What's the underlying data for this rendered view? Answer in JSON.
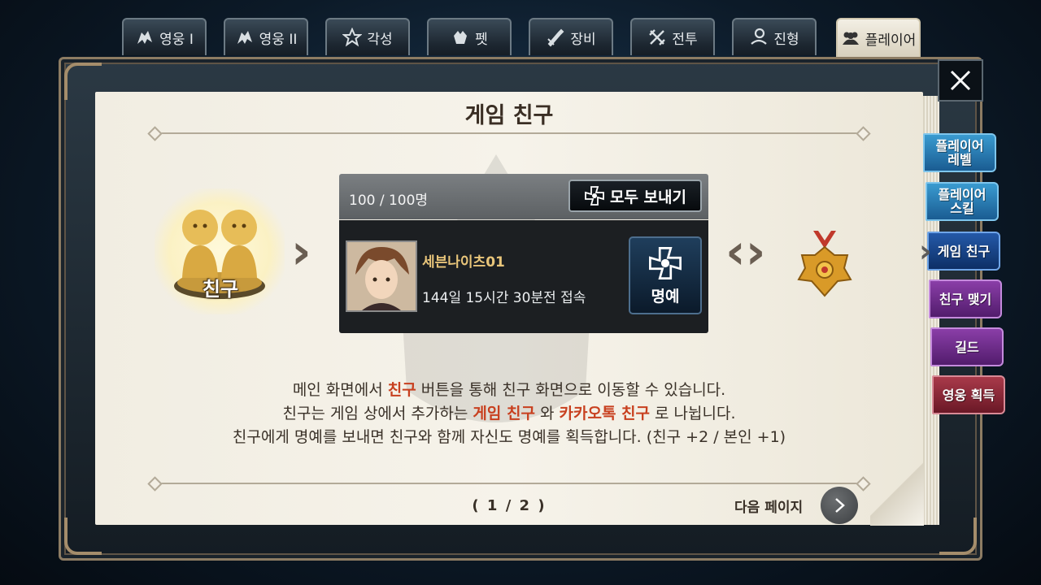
{
  "tabs": [
    {
      "label": "영웅 I",
      "icon": "hero-icon"
    },
    {
      "label": "영웅 II",
      "icon": "hero-icon"
    },
    {
      "label": "각성",
      "icon": "awakening-icon"
    },
    {
      "label": "펫",
      "icon": "pet-icon"
    },
    {
      "label": "장비",
      "icon": "equipment-icon"
    },
    {
      "label": "전투",
      "icon": "crossed-swords-icon"
    },
    {
      "label": "진형",
      "icon": "formation-icon"
    },
    {
      "label": "플레이어",
      "icon": "players-icon",
      "active": true
    }
  ],
  "page": {
    "title": "게임 친구",
    "badge_label": "친구",
    "pager": "( 1 / 2 )",
    "next_label": "다음 페이지"
  },
  "friends_panel": {
    "count": "100 / 100명",
    "send_all_label": "모두 보내기",
    "friend": {
      "name": "세븐나이츠01",
      "status": "144일 15시간 30분전 접속",
      "honor_label": "명예"
    }
  },
  "description": {
    "line1": {
      "pre": "메인 화면에서 ",
      "hl": "친구",
      "post": " 버튼을 통해 친구 화면으로 이동할 수 있습니다."
    },
    "line2": {
      "pre": "친구는 게임 상에서 추가하는 ",
      "hl1": "게임 친구",
      "mid": " 와 ",
      "hl2": "카카오톡 친구",
      "post": " 로 나뉩니다."
    },
    "line3": "친구에게 명예를 보내면 친구와 함께 자신도 명예를 획득합니다. (친구 +2 / 본인 +1)"
  },
  "side_tabs": [
    {
      "label1": "플레이어",
      "label2": "레벨",
      "color": "blue"
    },
    {
      "label1": "플레이어",
      "label2": "스킬",
      "color": "blue"
    },
    {
      "label1": "게임 친구",
      "label2": "",
      "color": "active"
    },
    {
      "label1": "친구 맺기",
      "label2": "",
      "color": "purple"
    },
    {
      "label1": "길드",
      "label2": "",
      "color": "purple"
    },
    {
      "label1": "영웅 획득",
      "label2": "",
      "color": "red"
    }
  ],
  "colors": {
    "highlight": "#c8401f",
    "friend_name": "#e8c57a",
    "page_bg": "#f3efe5"
  }
}
